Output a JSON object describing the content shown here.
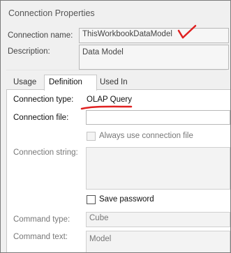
{
  "window": {
    "title": "Connection Properties"
  },
  "connection": {
    "name_label": "Connection name:",
    "name_value": "ThisWorkbookDataModel",
    "description_label": "Description:",
    "description_value": "Data Model"
  },
  "tabs": [
    {
      "label": "Usage",
      "active": false
    },
    {
      "label": "Definition",
      "active": true
    },
    {
      "label": "Used In",
      "active": false
    }
  ],
  "definition": {
    "connection_type_label": "Connection type:",
    "connection_type_value": "OLAP Query",
    "connection_file_label": "Connection file:",
    "connection_file_value": "",
    "always_use_label": "Always use connection file",
    "connection_string_label": "Connection string:",
    "connection_string_value": "",
    "save_password_label": "Save password",
    "command_type_label": "Command type:",
    "command_type_value": "Cube",
    "command_text_label": "Command text:",
    "command_text_value": "Model"
  },
  "annotations": {
    "checkmark_color": "#e02020",
    "underline_color": "#e02020"
  }
}
